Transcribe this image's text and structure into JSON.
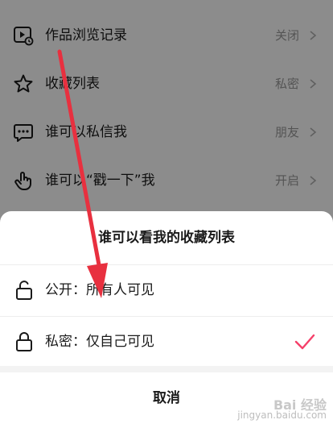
{
  "settings": {
    "items": [
      {
        "label": "作品浏览记录",
        "value": "关闭",
        "icon": "video-history-icon"
      },
      {
        "label": "收藏列表",
        "value": "私密",
        "icon": "star-icon"
      },
      {
        "label": "谁可以私信我",
        "value": "朋友",
        "icon": "message-icon"
      },
      {
        "label": "谁可以“戳一下”我",
        "value": "开启",
        "icon": "hand-tap-icon"
      }
    ]
  },
  "sheet": {
    "title": "谁可以看我的收藏列表",
    "options": [
      {
        "label": "公开：所有人可见",
        "icon": "unlock-icon",
        "selected": false
      },
      {
        "label": "私密：仅自己可见",
        "icon": "lock-icon",
        "selected": true
      }
    ],
    "cancel_label": "取消"
  },
  "colors": {
    "accent": "#f5406a",
    "annotation_arrow": "#e8303f",
    "text_primary": "#1a1a1a",
    "text_secondary": "#9a9a9a"
  },
  "watermark": {
    "main": "Bai 经验",
    "sub": "jingyan.baidu.com"
  }
}
